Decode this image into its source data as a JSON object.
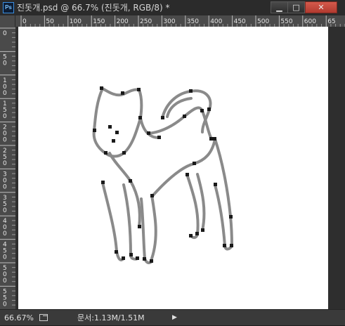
{
  "titlebar": {
    "app_icon": "Ps",
    "document_title": "진돗개.psd @ 66.7% (진돗개, RGB/8) *",
    "buttons": [
      "minimize",
      "maximize",
      "close"
    ]
  },
  "rulers": {
    "horizontal_labels": [
      "0",
      "50",
      "100",
      "150",
      "200",
      "250",
      "300",
      "350",
      "400",
      "450",
      "500",
      "550",
      "600",
      "65"
    ],
    "vertical_labels": [
      "0",
      "5\n0",
      "1\n0\n0",
      "1\n5\n0",
      "2\n0\n0",
      "2\n5\n0",
      "3\n0\n0",
      "3\n5\n0",
      "4\n0\n0",
      "4\n5\n0",
      "5\n0\n0",
      "5\n5\n0"
    ]
  },
  "canvas": {
    "content": "dog path outline",
    "path_color": "#8a8a8a",
    "anchor_color": "#1a1a1a"
  },
  "statusbar": {
    "zoom": "66.67%",
    "doc_info": "문서:1.13M/1.51M",
    "arrow": "▶"
  }
}
